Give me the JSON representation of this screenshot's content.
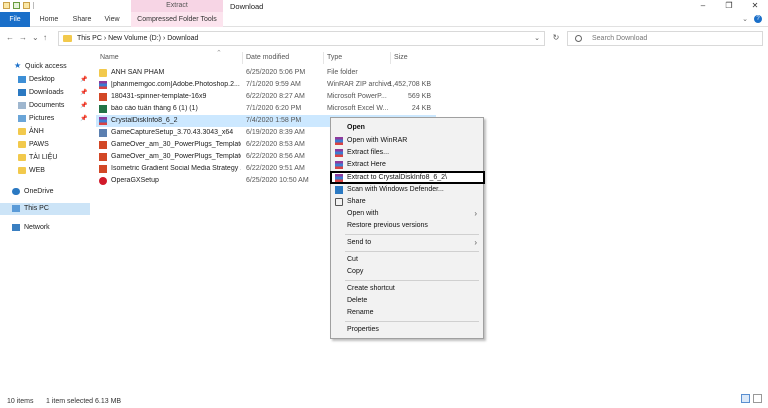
{
  "window": {
    "title": "Download",
    "context_tab_header": "Extract",
    "controls": [
      "–",
      "❐",
      "✕"
    ]
  },
  "ribbon": {
    "tabs": [
      "File",
      "Home",
      "Share",
      "View",
      "Compressed Folder Tools"
    ],
    "expand": "⌄",
    "help": "?"
  },
  "address": {
    "back": "←",
    "forward": "→",
    "up": "↑",
    "recent": "⌄",
    "crumbs": "This PC  ›  New Volume (D:)  ›  Download",
    "refresh": "↻",
    "search_placeholder": "Search Download"
  },
  "navpane": {
    "items": [
      {
        "label": "Quick access",
        "icon": "star-icon",
        "pinned": false
      },
      {
        "label": "Desktop",
        "icon": "desktop-icon",
        "pinned": true
      },
      {
        "label": "Downloads",
        "icon": "download-icon",
        "pinned": true
      },
      {
        "label": "Documents",
        "icon": "documents-icon",
        "pinned": true
      },
      {
        "label": "Pictures",
        "icon": "pictures-icon",
        "pinned": true
      },
      {
        "label": "ẢNH",
        "icon": "folder-icon",
        "pinned": false
      },
      {
        "label": "PAWS",
        "icon": "folder-icon",
        "pinned": false
      },
      {
        "label": "TÀI LIỆU",
        "icon": "folder-icon",
        "pinned": false
      },
      {
        "label": "WEB",
        "icon": "folder-icon",
        "pinned": false
      },
      {
        "label": "OneDrive",
        "icon": "cloud-icon",
        "pinned": false
      },
      {
        "label": "This PC",
        "icon": "pc-icon",
        "pinned": false
      },
      {
        "label": "Network",
        "icon": "network-icon",
        "pinned": false
      }
    ],
    "pin_glyph": "📌"
  },
  "columns": {
    "name": "Name",
    "date": "Date modified",
    "type": "Type",
    "size": "Size",
    "sort_glyph": "⌃"
  },
  "files": [
    {
      "name": "ẢNH SẢN PHẨM",
      "date": "6/25/2020 5:06 PM",
      "type": "File folder",
      "size": "",
      "icon": "folder-icon"
    },
    {
      "name": "[phanmemgoc.com]Adobe.Photoshop.2...",
      "date": "7/1/2020 9:59 AM",
      "type": "WinRAR ZIP archive",
      "size": "1,452,708 KB",
      "icon": "winrar-icon"
    },
    {
      "name": "180431-spinner-template-16x9",
      "date": "6/22/2020 8:27 AM",
      "type": "Microsoft PowerP...",
      "size": "569 KB",
      "icon": "powerpoint-icon"
    },
    {
      "name": "báo cáo tuần tháng 6 (1) (1)",
      "date": "7/1/2020 6:20 PM",
      "type": "Microsoft Excel W...",
      "size": "24 KB",
      "icon": "excel-icon"
    },
    {
      "name": "CrystalDiskInfo8_6_2",
      "date": "7/4/2020 1:58 PM",
      "type": "",
      "size": "",
      "icon": "winrar-icon"
    },
    {
      "name": "GameCaptureSetup_3.70.43.3043_x64",
      "date": "6/19/2020 8:39 AM",
      "type": "",
      "size": "",
      "icon": "setup-icon"
    },
    {
      "name": "GameOver_am_30_PowerPlugs_Template...",
      "date": "6/22/2020 8:53 AM",
      "type": "",
      "size": "",
      "icon": "powerpoint-icon"
    },
    {
      "name": "GameOver_am_30_PowerPlugs_Template...",
      "date": "6/22/2020 8:56 AM",
      "type": "",
      "size": "",
      "icon": "powerpoint-icon"
    },
    {
      "name": "Isometric Gradient Social Media Strategy ...",
      "date": "6/22/2020 9:51 AM",
      "type": "",
      "size": "",
      "icon": "powerpoint-icon"
    },
    {
      "name": "OperaGXSetup",
      "date": "6/25/2020 10:50 AM",
      "type": "",
      "size": "",
      "icon": "opera-icon"
    }
  ],
  "context_menu": {
    "items": [
      {
        "label": "Open",
        "icon": "",
        "bold": true,
        "submenu": false
      },
      {
        "label": "Open with WinRAR",
        "icon": "winrar-icon",
        "bold": false,
        "submenu": false
      },
      {
        "label": "Extract files...",
        "icon": "winrar-icon",
        "bold": false,
        "submenu": false
      },
      {
        "label": "Extract Here",
        "icon": "winrar-icon",
        "bold": false,
        "submenu": false
      },
      {
        "label": "Extract to CrystalDiskInfo8_6_2\\",
        "icon": "winrar-icon",
        "bold": false,
        "submenu": false,
        "highlighted": true
      },
      {
        "label": "Scan with Windows Defender...",
        "icon": "defender-icon",
        "bold": false,
        "submenu": false
      },
      {
        "label": "Share",
        "icon": "share-icon",
        "bold": false,
        "submenu": false
      },
      {
        "label": "Open with",
        "icon": "",
        "bold": false,
        "submenu": true
      },
      {
        "label": "Restore previous versions",
        "icon": "",
        "bold": false,
        "submenu": false
      },
      {
        "label": "Send to",
        "icon": "",
        "bold": false,
        "submenu": true
      },
      {
        "label": "Cut",
        "icon": "",
        "bold": false,
        "submenu": false
      },
      {
        "label": "Copy",
        "icon": "",
        "bold": false,
        "submenu": false
      },
      {
        "label": "Create shortcut",
        "icon": "",
        "bold": false,
        "submenu": false
      },
      {
        "label": "Delete",
        "icon": "",
        "bold": false,
        "submenu": false
      },
      {
        "label": "Rename",
        "icon": "",
        "bold": false,
        "submenu": false
      },
      {
        "label": "Properties",
        "icon": "",
        "bold": false,
        "submenu": false
      }
    ],
    "submenu_glyph": "›"
  },
  "status": {
    "count": "10 items",
    "selection": "1 item selected  6.13 MB"
  }
}
